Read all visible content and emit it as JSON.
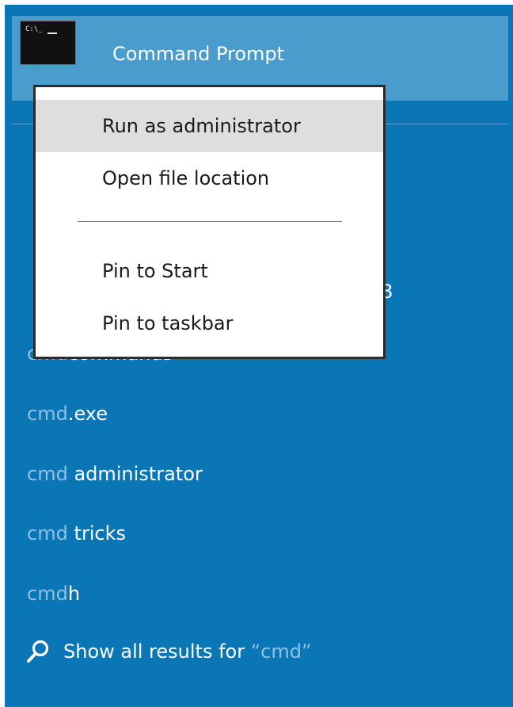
{
  "top_result": {
    "title": "Command Prompt",
    "icon": "command-prompt-icon",
    "icon_glyph": "C:\\_"
  },
  "context_menu": {
    "items": [
      {
        "label": "Run as administrator",
        "highlighted": true
      },
      {
        "label": "Open file location",
        "highlighted": false
      },
      {
        "label": "Pin to Start",
        "highlighted": false
      },
      {
        "label": "Pin to taskbar",
        "highlighted": false
      }
    ]
  },
  "obscured": {
    "partial_text_right": "8",
    "partial_row": {
      "query": "cmd",
      "rest": "commands"
    }
  },
  "suggestions": [
    {
      "query": "cmd",
      "rest": ".exe"
    },
    {
      "query": "cmd",
      "rest": " administrator"
    },
    {
      "query": "cmd",
      "rest": " tricks"
    },
    {
      "query": "cmd",
      "rest": "h"
    }
  ],
  "show_all": {
    "prefix": "Show all results for ",
    "query": "“cmd”",
    "icon": "search-icon"
  },
  "colors": {
    "panel_bg": "#0a76b6",
    "top_result_bg": "#4a9ccd",
    "query_highlight": "#8fc1e3",
    "menu_highlight": "#dedede"
  }
}
